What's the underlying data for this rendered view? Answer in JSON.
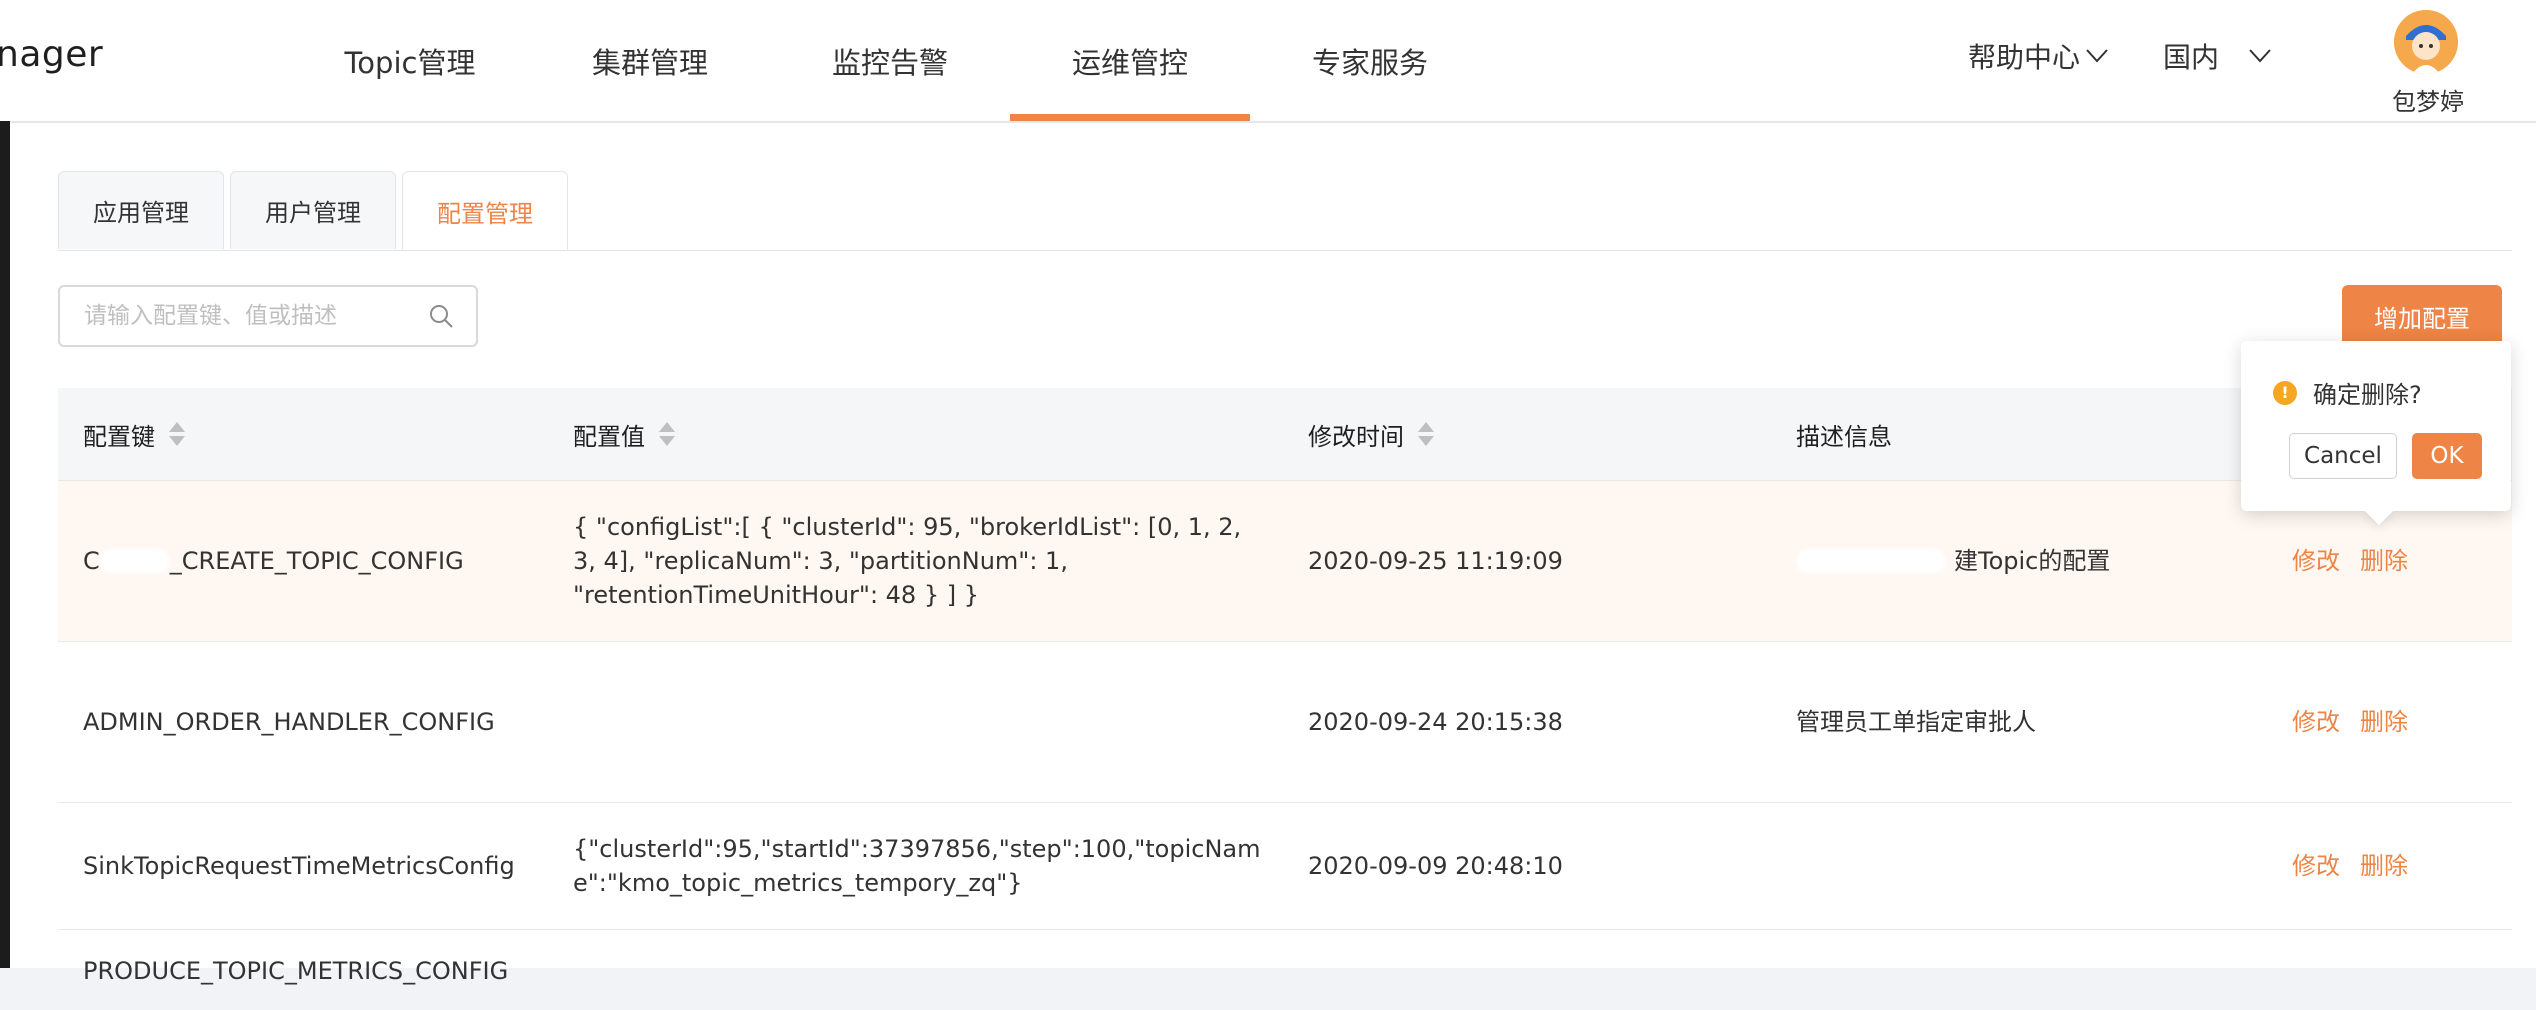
{
  "header": {
    "logo_text": "nager",
    "nav": [
      {
        "label": "Topic管理"
      },
      {
        "label": "集群管理"
      },
      {
        "label": "监控告警"
      },
      {
        "label": "运维管控",
        "active": true
      },
      {
        "label": "专家服务"
      }
    ],
    "help_label": "帮助中心",
    "region_label": "国内",
    "user_name": "包梦婷"
  },
  "tabs": [
    {
      "label": "应用管理"
    },
    {
      "label": "用户管理"
    },
    {
      "label": "配置管理",
      "active": true
    }
  ],
  "search": {
    "placeholder": "请输入配置键、值或描述"
  },
  "add_button_label": "增加配置",
  "table": {
    "columns": [
      {
        "label": "配置键",
        "sortable": true
      },
      {
        "label": "配置值",
        "sortable": true
      },
      {
        "label": "修改时间",
        "sortable": true
      },
      {
        "label": "描述信息",
        "sortable": false
      }
    ],
    "rows": [
      {
        "key": "_CREATE_TOPIC_CONFIG",
        "key_prefix": "C",
        "value": "{ \"configList\":[ { \"clusterId\": 95, \"brokerIdList\": [0, 1, 2, 3, 4], \"replicaNum\": 3, \"partitionNum\": 1, \"retentionTimeUnitHour\": 48 } ] }",
        "modified": "2020-09-25 11:19:09",
        "desc": "建Topic的配置",
        "highlight": true
      },
      {
        "key": "ADMIN_ORDER_HANDLER_CONFIG",
        "value": "",
        "modified": "2020-09-24 20:15:38",
        "desc": "管理员工单指定审批人"
      },
      {
        "key": "SinkTopicRequestTimeMetricsConfig",
        "value": "{\"clusterId\":95,\"startId\":37397856,\"step\":100,\"topicName\":\"kmo_topic_metrics_tempory_zq\"}",
        "modified": "2020-09-09 20:48:10",
        "desc": ""
      },
      {
        "key": "PRODUCE_TOPIC_METRICS_CONFIG",
        "value": "",
        "modified": "",
        "desc": ""
      }
    ],
    "actions": {
      "edit": "修改",
      "delete": "删除"
    }
  },
  "popconfirm": {
    "title": "确定删除?",
    "cancel": "Cancel",
    "ok": "OK"
  },
  "colors": {
    "accent": "#ee8445",
    "warning": "#f5a623"
  }
}
